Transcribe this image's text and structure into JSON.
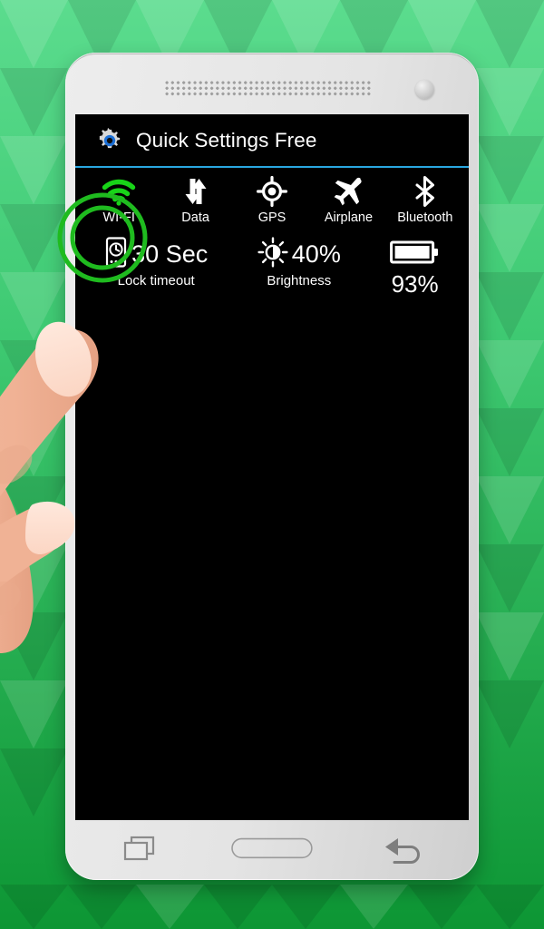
{
  "app": {
    "title": "Quick Settings Free",
    "gear_icon": "gear-icon",
    "accent_color": "#29a7e0",
    "screen_bg": "#000000"
  },
  "toggles": [
    {
      "label": "WI-FI",
      "icon": "wifi-icon",
      "state": "on",
      "color": "#1fd61f"
    },
    {
      "label": "Data",
      "icon": "data-icon",
      "state": "off",
      "color": "#ffffff"
    },
    {
      "label": "GPS",
      "icon": "gps-icon",
      "state": "off",
      "color": "#ffffff"
    },
    {
      "label": "Airplane",
      "icon": "airplane-icon",
      "state": "off",
      "color": "#ffffff"
    },
    {
      "label": "Bluetooth",
      "icon": "bluetooth-icon",
      "state": "off",
      "color": "#ffffff"
    }
  ],
  "status": {
    "lock_timeout": {
      "value": "30 Sec",
      "caption": "Lock timeout",
      "icon": "phone-clock-icon"
    },
    "brightness": {
      "value": "40%",
      "caption": "Brightness",
      "icon": "brightness-sun-icon"
    },
    "battery": {
      "value": "93%",
      "caption": "",
      "icon": "battery-icon",
      "level_percent": 93
    }
  },
  "navigation": {
    "recents_label": "Recents",
    "home_label": "Home",
    "back_label": "Back"
  },
  "hardware": {
    "speaker_label": "Earpiece speaker",
    "camera_label": "Front camera"
  },
  "interaction": {
    "tap_target": "WI-FI",
    "tap_ring_color": "#22c022"
  },
  "background": {
    "style": "green-triangles",
    "colors": [
      "#55d98a",
      "#3fca73",
      "#28b254",
      "#119b3a"
    ]
  }
}
